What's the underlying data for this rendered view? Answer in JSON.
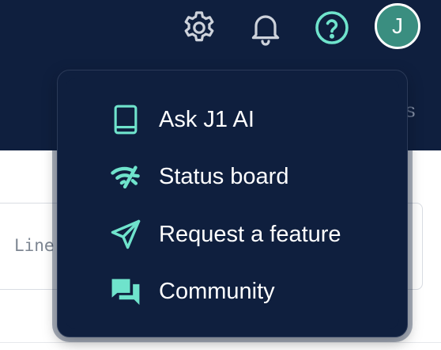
{
  "header": {
    "tabs_peek_text": "cs",
    "avatar_initial": "J"
  },
  "input": {
    "placeholder": "Line"
  },
  "help_menu": {
    "items": [
      {
        "label": "Ask J1 AI",
        "icon": "book-icon"
      },
      {
        "label": "Status board",
        "icon": "signal-icon"
      },
      {
        "label": "Request a feature",
        "icon": "send-icon"
      },
      {
        "label": "Community",
        "icon": "forum-icon"
      }
    ]
  },
  "colors": {
    "header_bg": "#0f1f3e",
    "accent": "#6fe3cc",
    "avatar_bg": "#3a8e80",
    "icon_gray": "#cdd2db"
  }
}
